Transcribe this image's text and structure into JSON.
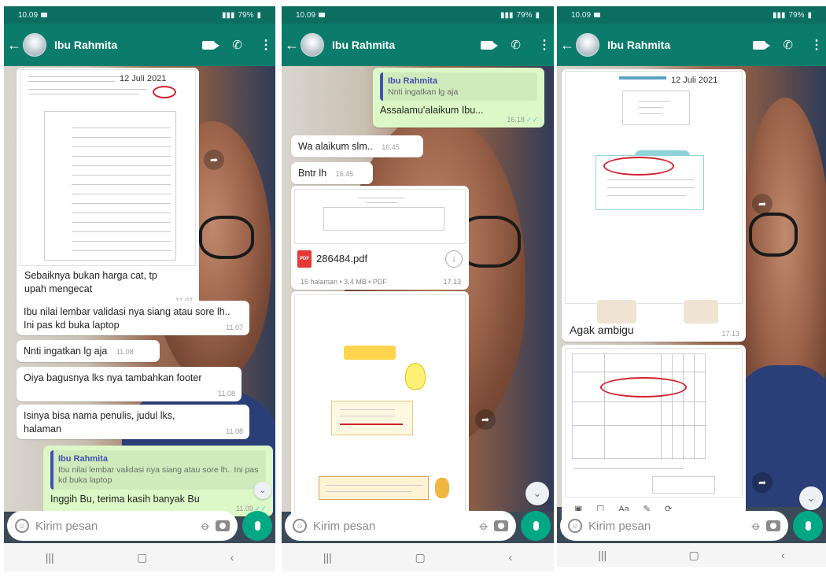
{
  "status": {
    "time": "10.09",
    "battery": "79%"
  },
  "contact": {
    "name": "Ibu Rahmita"
  },
  "input": {
    "placeholder": "Kirim pesan"
  },
  "panel1": {
    "doc_date": "12 Juli 2021",
    "messages": [
      {
        "text": "Sebaiknya bukan harga cat,  tp upah mengecat",
        "time": "11.07"
      },
      {
        "text": "Ibu nilai lembar validasi nya siang atau sore lh.. Ini pas kd buka laptop",
        "time": "11.07"
      },
      {
        "text": "Nnti ingatkan lg aja",
        "time": "11.08"
      },
      {
        "text": "Oiya bagusnya lks nya tambahkan footer",
        "time": "11.08"
      },
      {
        "text": "Isinya bisa nama penulis, judul lks, halaman",
        "time": "11.08"
      }
    ],
    "reply": {
      "quote_name": "Ibu Rahmita",
      "quote_text": "Ibu nilai lembar validasi nya siang atau sore lh.. Ini pas kd buka laptop",
      "text": "Inggih Bu, terima kasih banyak Bu",
      "time": "11.09"
    }
  },
  "panel2": {
    "reply": {
      "quote_name": "Ibu Rahmita",
      "quote_text": "Nnti ingatkan lg aja",
      "text": "Assalamu'alaikum Ibu...",
      "time": "16.18"
    },
    "messages": [
      {
        "text": "Wa alaikum slm..",
        "time": "16.45"
      },
      {
        "text": "Bntr lh",
        "time": "16.45"
      }
    ],
    "pdf": {
      "badge": "PDF",
      "name": "286484.pdf",
      "meta": "15 halaman • 3,4 MB • PDF",
      "time": "17.13"
    }
  },
  "panel3": {
    "doc_date": "12 Juli 2021",
    "message": {
      "text": "Agak ambigu",
      "time": "17.13"
    }
  }
}
